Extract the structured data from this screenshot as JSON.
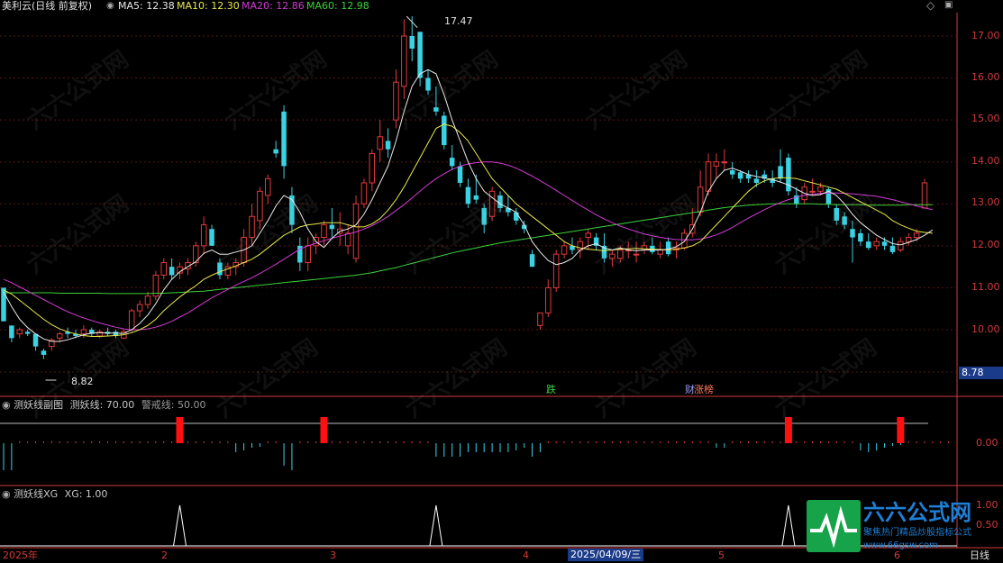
{
  "header": {
    "stock_name": "美利云(日线 前复权)",
    "ma5": "MA5: 12.38",
    "ma10": "MA10: 12.30",
    "ma20": "MA20: 12.86",
    "ma60": "MA60: 12.98",
    "ma_colors": {
      "ma5": "#e8e8e8",
      "ma10": "#e8e84a",
      "ma20": "#d23ad2",
      "ma60": "#3ad23a"
    }
  },
  "price_axis": {
    "ticks": [
      "17.00",
      "16.00",
      "15.00",
      "14.00",
      "13.00",
      "12.00",
      "11.00",
      "10.00"
    ],
    "current_price": "8.78"
  },
  "annotations": {
    "high": "17.47",
    "low": "8.82",
    "tag_fall": "跌",
    "tag_fin": "财",
    "tag_rank": "涨榜"
  },
  "indicator1": {
    "title": "测妖线副图",
    "line": "测妖线: 70.00",
    "warn": "警戒线: 50.00",
    "axis_label": "0.00"
  },
  "indicator2": {
    "title": "测妖线XG",
    "value": "XG: 1.00",
    "axis_top": "1.00",
    "axis_mid": "0.50"
  },
  "bottom_axis": {
    "year": "2025年",
    "m2": "2",
    "m3": "3",
    "m4": "4",
    "m5": "5",
    "m6": "6",
    "cursor_date": "2025/04/09/三",
    "period": "日线"
  },
  "brand": {
    "name": "六六公式网",
    "slogan": "聚焦热门精品炒股指标公式",
    "url": "www.66gsw.com",
    "watermark": "六六公式网"
  },
  "icons": {
    "settings": "gear-icon",
    "scroll_up": "arrow-up-icon",
    "collapse": "chevron-down-icon"
  },
  "colors": {
    "up": "#e23a3a",
    "down": "#3ad2e2",
    "axis": "#d23a3a",
    "bg": "#000000"
  },
  "chart_data": {
    "type": "candlestick",
    "ylim": [
      9.3,
      17.8
    ],
    "candles": [
      [
        11.0,
        11.0,
        10.2,
        10.2
      ],
      [
        10.1,
        10.0,
        9.7,
        9.8
      ],
      [
        9.9,
        10.05,
        9.8,
        10.0
      ],
      [
        9.95,
        10.0,
        9.85,
        9.9
      ],
      [
        9.9,
        9.9,
        9.5,
        9.6
      ],
      [
        9.5,
        9.55,
        9.3,
        9.4
      ],
      [
        9.6,
        9.8,
        9.5,
        9.75
      ],
      [
        9.8,
        9.95,
        9.7,
        9.9
      ],
      [
        9.95,
        10.05,
        9.8,
        9.9
      ],
      [
        9.9,
        10.0,
        9.8,
        9.85
      ],
      [
        9.9,
        10.1,
        9.8,
        10.0
      ],
      [
        10.0,
        10.05,
        9.85,
        9.9
      ],
      [
        9.85,
        10.0,
        9.8,
        9.95
      ],
      [
        9.95,
        10.05,
        9.85,
        9.9
      ],
      [
        9.95,
        10.0,
        9.8,
        9.85
      ],
      [
        9.8,
        10.0,
        9.8,
        9.95
      ],
      [
        10.0,
        10.5,
        9.95,
        10.45
      ],
      [
        10.45,
        10.7,
        10.3,
        10.6
      ],
      [
        10.6,
        10.9,
        10.5,
        10.8
      ],
      [
        10.8,
        11.4,
        10.7,
        11.3
      ],
      [
        11.3,
        11.7,
        11.2,
        11.6
      ],
      [
        11.5,
        11.7,
        11.2,
        11.3
      ],
      [
        11.35,
        11.6,
        11.2,
        11.5
      ],
      [
        11.45,
        11.7,
        11.3,
        11.6
      ],
      [
        11.6,
        12.1,
        11.5,
        12.0
      ],
      [
        12.0,
        12.7,
        11.8,
        12.5
      ],
      [
        12.4,
        12.5,
        12.0,
        12.0
      ],
      [
        11.6,
        11.7,
        11.2,
        11.3
      ],
      [
        11.3,
        11.6,
        11.2,
        11.5
      ],
      [
        11.5,
        11.7,
        11.3,
        11.6
      ],
      [
        11.6,
        12.4,
        11.5,
        12.2
      ],
      [
        12.2,
        13.0,
        12.0,
        12.7
      ],
      [
        12.6,
        13.4,
        12.4,
        13.3
      ],
      [
        13.2,
        13.7,
        13.0,
        13.6
      ],
      [
        14.3,
        14.5,
        14.1,
        14.2
      ],
      [
        15.2,
        15.35,
        13.6,
        13.9
      ],
      [
        13.2,
        13.4,
        12.3,
        12.5
      ],
      [
        12.0,
        12.2,
        11.4,
        11.6
      ],
      [
        11.6,
        12.2,
        11.4,
        12.0
      ],
      [
        12.0,
        12.3,
        11.8,
        12.2
      ],
      [
        12.2,
        12.6,
        12.0,
        12.5
      ],
      [
        12.5,
        12.9,
        12.2,
        12.4
      ],
      [
        12.3,
        12.8,
        12.0,
        12.4
      ],
      [
        12.0,
        12.5,
        11.8,
        12.3
      ],
      [
        11.7,
        13.2,
        11.6,
        13.0
      ],
      [
        13.0,
        13.6,
        12.9,
        13.5
      ],
      [
        13.5,
        14.3,
        13.3,
        14.2
      ],
      [
        14.3,
        15.0,
        14.0,
        14.6
      ],
      [
        14.5,
        14.8,
        14.1,
        14.3
      ],
      [
        15.0,
        16.2,
        14.8,
        15.9
      ],
      [
        15.8,
        17.4,
        15.5,
        17.0
      ],
      [
        17.0,
        17.47,
        16.4,
        16.7
      ],
      [
        17.1,
        17.1,
        15.8,
        16.0
      ],
      [
        16.0,
        16.2,
        15.6,
        15.7
      ],
      [
        15.3,
        15.8,
        15.1,
        15.2
      ],
      [
        15.1,
        15.2,
        14.3,
        14.4
      ],
      [
        14.1,
        14.4,
        13.8,
        13.9
      ],
      [
        13.9,
        14.0,
        13.4,
        13.5
      ],
      [
        13.4,
        13.6,
        12.9,
        13.0
      ],
      [
        13.2,
        13.7,
        13.0,
        13.1
      ],
      [
        12.9,
        13.0,
        12.3,
        12.5
      ],
      [
        12.7,
        13.4,
        12.6,
        13.3
      ],
      [
        13.2,
        13.3,
        12.8,
        12.9
      ],
      [
        12.9,
        13.2,
        12.7,
        12.8
      ],
      [
        12.8,
        12.9,
        12.5,
        12.6
      ],
      [
        12.5,
        12.6,
        12.3,
        12.4
      ],
      [
        11.8,
        11.9,
        11.5,
        11.5
      ],
      [
        10.1,
        10.4,
        10.0,
        10.4
      ],
      [
        10.4,
        11.2,
        10.3,
        11.0
      ],
      [
        11.0,
        11.9,
        10.9,
        11.8
      ],
      [
        11.8,
        12.1,
        11.7,
        12.0
      ],
      [
        12.0,
        12.2,
        11.8,
        11.9
      ],
      [
        11.9,
        12.2,
        11.7,
        12.1
      ],
      [
        12.2,
        12.4,
        11.9,
        12.3
      ],
      [
        12.2,
        12.3,
        11.9,
        12.0
      ],
      [
        12.0,
        12.3,
        11.6,
        11.7
      ],
      [
        11.7,
        11.9,
        11.5,
        11.8
      ],
      [
        11.7,
        12.0,
        11.6,
        11.9
      ],
      [
        11.9,
        12.1,
        11.7,
        11.9
      ],
      [
        11.8,
        12.1,
        11.6,
        11.8
      ],
      [
        11.9,
        12.1,
        11.8,
        12.0
      ],
      [
        12.0,
        12.2,
        11.8,
        11.85
      ],
      [
        11.8,
        12.1,
        11.7,
        11.9
      ],
      [
        12.1,
        12.2,
        11.75,
        11.8
      ],
      [
        11.9,
        12.1,
        11.7,
        11.95
      ],
      [
        11.95,
        12.4,
        11.9,
        12.3
      ],
      [
        12.3,
        12.9,
        12.2,
        12.5
      ],
      [
        12.8,
        13.8,
        12.7,
        13.4
      ],
      [
        13.3,
        14.2,
        13.2,
        14.0
      ],
      [
        13.9,
        14.2,
        13.6,
        14.0
      ],
      [
        14.0,
        14.3,
        13.8,
        14.0
      ],
      [
        13.8,
        14.0,
        13.6,
        13.7
      ],
      [
        13.75,
        13.8,
        13.5,
        13.6
      ],
      [
        13.7,
        13.8,
        13.5,
        13.6
      ],
      [
        13.6,
        13.8,
        13.4,
        13.5
      ],
      [
        13.7,
        13.8,
        13.5,
        13.6
      ],
      [
        13.6,
        13.8,
        13.4,
        13.5
      ],
      [
        13.9,
        14.3,
        13.5,
        13.6
      ],
      [
        14.1,
        14.2,
        13.2,
        13.3
      ],
      [
        13.2,
        13.4,
        12.9,
        13.0
      ],
      [
        13.1,
        13.5,
        13.0,
        13.4
      ],
      [
        13.3,
        13.6,
        13.2,
        13.3
      ],
      [
        13.3,
        13.5,
        13.2,
        13.4
      ],
      [
        13.35,
        13.4,
        12.9,
        13.0
      ],
      [
        12.9,
        13.0,
        12.5,
        12.6
      ],
      [
        12.7,
        12.8,
        12.4,
        12.5
      ],
      [
        12.4,
        12.6,
        11.6,
        12.2
      ],
      [
        12.3,
        12.4,
        12.0,
        12.1
      ],
      [
        12.1,
        12.3,
        11.9,
        11.95
      ],
      [
        12.0,
        12.2,
        11.9,
        12.1
      ],
      [
        12.1,
        12.2,
        11.9,
        12.0
      ],
      [
        12.0,
        12.2,
        11.8,
        11.85
      ],
      [
        11.9,
        12.2,
        11.85,
        12.1
      ],
      [
        12.1,
        12.3,
        12.0,
        12.2
      ],
      [
        12.2,
        12.4,
        12.1,
        12.3
      ],
      [
        12.9,
        13.6,
        12.9,
        13.5
      ]
    ],
    "ma5": [
      10.9,
      10.55,
      10.25,
      10.05,
      9.9,
      9.78,
      9.72,
      9.72,
      9.76,
      9.82,
      9.88,
      9.92,
      9.93,
      9.92,
      9.92,
      9.91,
      10.0,
      10.15,
      10.35,
      10.62,
      10.95,
      11.2,
      11.38,
      11.5,
      11.62,
      11.82,
      11.9,
      11.8,
      11.8,
      11.85,
      11.9,
      12.0,
      12.3,
      12.6,
      12.95,
      13.2,
      13.1,
      12.8,
      12.4,
      12.1,
      11.96,
      12.18,
      12.35,
      12.4,
      12.5,
      12.75,
      13.1,
      13.5,
      13.9,
      14.5,
      15.2,
      15.8,
      16.1,
      16.2,
      16.1,
      15.6,
      15.0,
      14.5,
      14.0,
      13.6,
      13.3,
      13.15,
      13.0,
      12.9,
      12.8,
      12.5,
      12.1,
      11.85,
      11.65,
      11.55,
      11.6,
      11.7,
      11.9,
      12.0,
      12.05,
      11.95,
      11.9,
      11.95,
      11.9,
      11.88,
      11.9,
      11.9,
      11.9,
      11.92,
      11.98,
      12.1,
      12.4,
      12.8,
      13.3,
      13.6,
      13.8,
      13.85,
      13.78,
      13.7,
      13.65,
      13.62,
      13.58,
      13.52,
      13.45,
      13.35,
      13.25,
      13.2,
      13.22,
      13.3,
      13.2,
      13.0,
      12.75,
      12.55,
      12.4,
      12.25,
      12.15,
      12.05,
      12.02,
      12.08,
      12.15,
      12.25,
      12.38
    ],
    "ma10": [
      10.95,
      10.85,
      10.7,
      10.55,
      10.4,
      10.25,
      10.12,
      10.02,
      9.95,
      9.9,
      9.86,
      9.84,
      9.84,
      9.85,
      9.86,
      9.88,
      9.93,
      10.0,
      10.1,
      10.25,
      10.45,
      10.62,
      10.78,
      10.92,
      11.05,
      11.2,
      11.3,
      11.38,
      11.45,
      11.52,
      11.6,
      11.68,
      11.8,
      11.95,
      12.1,
      12.25,
      12.35,
      12.45,
      12.5,
      12.52,
      12.55,
      12.55,
      12.55,
      12.5,
      12.45,
      12.45,
      12.52,
      12.65,
      12.85,
      13.1,
      13.4,
      13.75,
      14.1,
      14.45,
      14.8,
      14.9,
      14.85,
      14.7,
      14.5,
      14.2,
      13.9,
      13.6,
      13.4,
      13.2,
      13.0,
      12.85,
      12.7,
      12.55,
      12.4,
      12.25,
      12.1,
      12.0,
      11.95,
      11.92,
      11.9,
      11.88,
      11.9,
      11.92,
      11.93,
      11.94,
      11.93,
      11.92,
      11.91,
      11.9,
      11.92,
      11.95,
      12.0,
      12.1,
      12.3,
      12.5,
      12.7,
      12.9,
      13.1,
      13.3,
      13.45,
      13.55,
      13.6,
      13.62,
      13.62,
      13.6,
      13.55,
      13.5,
      13.45,
      13.4,
      13.35,
      13.25,
      13.15,
      13.05,
      12.95,
      12.85,
      12.75,
      12.6,
      12.5,
      12.42,
      12.35,
      12.32,
      12.3
    ],
    "ma20": [
      11.2,
      11.12,
      11.02,
      10.92,
      10.82,
      10.72,
      10.62,
      10.52,
      10.43,
      10.35,
      10.28,
      10.22,
      10.16,
      10.11,
      10.06,
      10.02,
      10.0,
      10.0,
      10.02,
      10.06,
      10.12,
      10.2,
      10.3,
      10.4,
      10.52,
      10.64,
      10.76,
      10.86,
      10.96,
      11.06,
      11.15,
      11.24,
      11.34,
      11.45,
      11.56,
      11.68,
      11.8,
      11.92,
      12.0,
      12.06,
      12.12,
      12.18,
      12.23,
      12.28,
      12.33,
      12.4,
      12.48,
      12.58,
      12.7,
      12.84,
      12.98,
      13.14,
      13.3,
      13.46,
      13.6,
      13.72,
      13.82,
      13.9,
      13.95,
      13.98,
      14.0,
      14.0,
      13.97,
      13.92,
      13.85,
      13.76,
      13.66,
      13.55,
      13.44,
      13.32,
      13.2,
      13.08,
      12.96,
      12.85,
      12.74,
      12.64,
      12.55,
      12.47,
      12.4,
      12.34,
      12.28,
      12.24,
      12.2,
      12.17,
      12.15,
      12.14,
      12.14,
      12.16,
      12.2,
      12.26,
      12.34,
      12.44,
      12.55,
      12.66,
      12.76,
      12.86,
      12.95,
      13.03,
      13.1,
      13.16,
      13.2,
      13.23,
      13.25,
      13.26,
      13.26,
      13.25,
      13.24,
      13.22,
      13.2,
      13.18,
      13.14,
      13.1,
      13.05,
      13.0,
      12.95,
      12.9,
      12.86
    ],
    "ma60": [
      10.88,
      10.88,
      10.88,
      10.88,
      10.88,
      10.88,
      10.88,
      10.87,
      10.87,
      10.87,
      10.87,
      10.87,
      10.87,
      10.86,
      10.86,
      10.86,
      10.86,
      10.86,
      10.86,
      10.87,
      10.87,
      10.88,
      10.89,
      10.9,
      10.91,
      10.92,
      10.94,
      10.96,
      10.98,
      11.0,
      11.02,
      11.04,
      11.06,
      11.08,
      11.1,
      11.12,
      11.14,
      11.16,
      11.18,
      11.2,
      11.22,
      11.24,
      11.26,
      11.28,
      11.3,
      11.33,
      11.36,
      11.4,
      11.44,
      11.48,
      11.53,
      11.58,
      11.63,
      11.68,
      11.73,
      11.78,
      11.83,
      11.87,
      11.91,
      11.95,
      11.99,
      12.03,
      12.07,
      12.1,
      12.13,
      12.16,
      12.19,
      12.22,
      12.25,
      12.28,
      12.31,
      12.34,
      12.37,
      12.4,
      12.43,
      12.46,
      12.49,
      12.52,
      12.55,
      12.58,
      12.61,
      12.64,
      12.67,
      12.7,
      12.73,
      12.76,
      12.79,
      12.82,
      12.85,
      12.88,
      12.91,
      12.93,
      12.95,
      12.97,
      12.98,
      12.99,
      13.0,
      13.0,
      13.0,
      13.0,
      13.0,
      13.0,
      12.99,
      12.99,
      12.98,
      12.98,
      12.98,
      12.98,
      12.97,
      12.97,
      12.97,
      12.97,
      12.97,
      12.98,
      12.98,
      12.98,
      12.98
    ],
    "indicator1_bars": [
      -30,
      -30,
      0,
      0,
      0,
      0,
      0,
      0,
      0,
      0,
      0,
      0,
      0,
      0,
      0,
      0,
      0,
      0,
      0,
      0,
      0,
      0,
      0,
      0,
      0,
      0,
      0,
      0,
      0,
      -10,
      -8,
      -5,
      -4,
      0,
      0,
      -25,
      -30,
      0,
      0,
      0,
      0,
      0,
      0,
      0,
      0,
      0,
      0,
      0,
      0,
      0,
      0,
      0,
      0,
      0,
      -15,
      -15,
      -15,
      -15,
      -10,
      -10,
      -10,
      -10,
      -10,
      -10,
      -8,
      -5,
      -15,
      -10,
      0,
      0,
      0,
      0,
      0,
      0,
      0,
      0,
      0,
      0,
      0,
      0,
      0,
      0,
      0,
      0,
      0,
      0,
      0,
      0,
      0,
      -5,
      -5,
      0,
      0,
      0,
      0,
      0,
      0,
      0,
      0,
      0,
      0,
      0,
      0,
      0,
      0,
      0,
      0,
      -8,
      -10,
      -8,
      -5,
      -3,
      -2,
      0,
      0,
      0,
      0,
      0,
      0
    ],
    "indicator1_signals": [
      22,
      40,
      98,
      112
    ],
    "xg_peaks": [
      22,
      54,
      98
    ]
  }
}
